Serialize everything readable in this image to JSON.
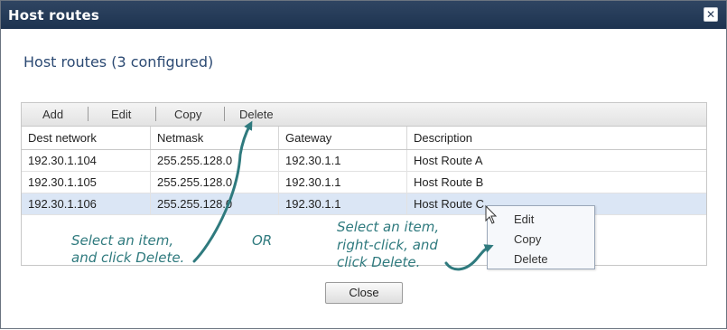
{
  "window": {
    "title": "Host routes",
    "close_icon": "close-icon"
  },
  "heading": "Host routes (3 configured)",
  "toolbar": {
    "add": "Add",
    "edit": "Edit",
    "copy": "Copy",
    "delete": "Delete"
  },
  "table": {
    "columns": [
      "Dest network",
      "Netmask",
      "Gateway",
      "Description"
    ],
    "rows": [
      [
        "192.30.1.104",
        "255.255.128.0",
        "192.30.1.1",
        "Host Route A"
      ],
      [
        "192.30.1.105",
        "255.255.128.0",
        "192.30.1.1",
        "Host Route B"
      ],
      [
        "192.30.1.106",
        "255.255.128.0",
        "192.30.1.1",
        "Host Route C"
      ]
    ],
    "selected_row": 3
  },
  "context_menu": {
    "items": [
      "Edit",
      "Copy",
      "Delete"
    ]
  },
  "annotations": {
    "left_line1": "Select an item,",
    "left_line2": "and click Delete.",
    "or": "OR",
    "right_line1": "Select an item,",
    "right_line2": "right-click, and",
    "right_line3": "click Delete."
  },
  "footer": {
    "close": "Close"
  },
  "colors": {
    "titlebar": "#1d3350",
    "heading": "#2c4a73",
    "annotation": "#2f7a7e",
    "selected_row": "#dbe6f5"
  }
}
